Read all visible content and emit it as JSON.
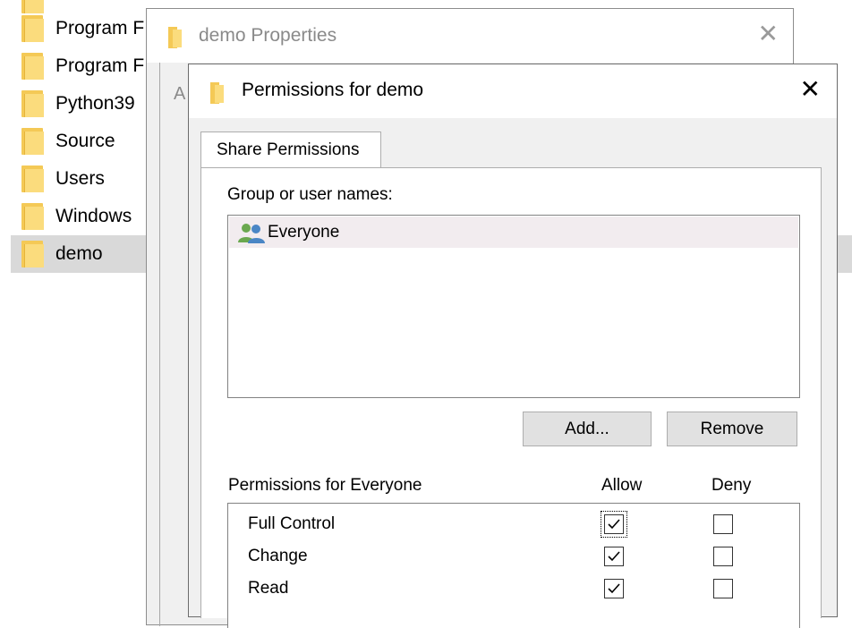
{
  "explorer": {
    "items": [
      {
        "label": "Program F"
      },
      {
        "label": "Program F"
      },
      {
        "label": "Python39"
      },
      {
        "label": "Source"
      },
      {
        "label": "Users"
      },
      {
        "label": "Windows"
      },
      {
        "label": "demo",
        "selected": true
      }
    ]
  },
  "properties_window": {
    "title": "demo Properties",
    "partial_tab_text": "A",
    "close_glyph": "✕"
  },
  "permissions_window": {
    "title": "Permissions for demo",
    "close_glyph": "✕",
    "tab_label": "Share Permissions",
    "group_label": "Group or user names:",
    "users": [
      {
        "name": "Everyone",
        "icon": "users-group-icon",
        "selected": true
      }
    ],
    "add_button": "Add...",
    "remove_button": "Remove",
    "permissions_header": "Permissions for Everyone",
    "allow_header": "Allow",
    "deny_header": "Deny",
    "permissions": [
      {
        "name": "Full Control",
        "allow": true,
        "deny": false,
        "focused": true
      },
      {
        "name": "Change",
        "allow": true,
        "deny": false
      },
      {
        "name": "Read",
        "allow": true,
        "deny": false
      }
    ]
  },
  "colors": {
    "folder": "#f4c956",
    "selection": "#d9d9d9",
    "button_face": "#e1e1e1"
  }
}
